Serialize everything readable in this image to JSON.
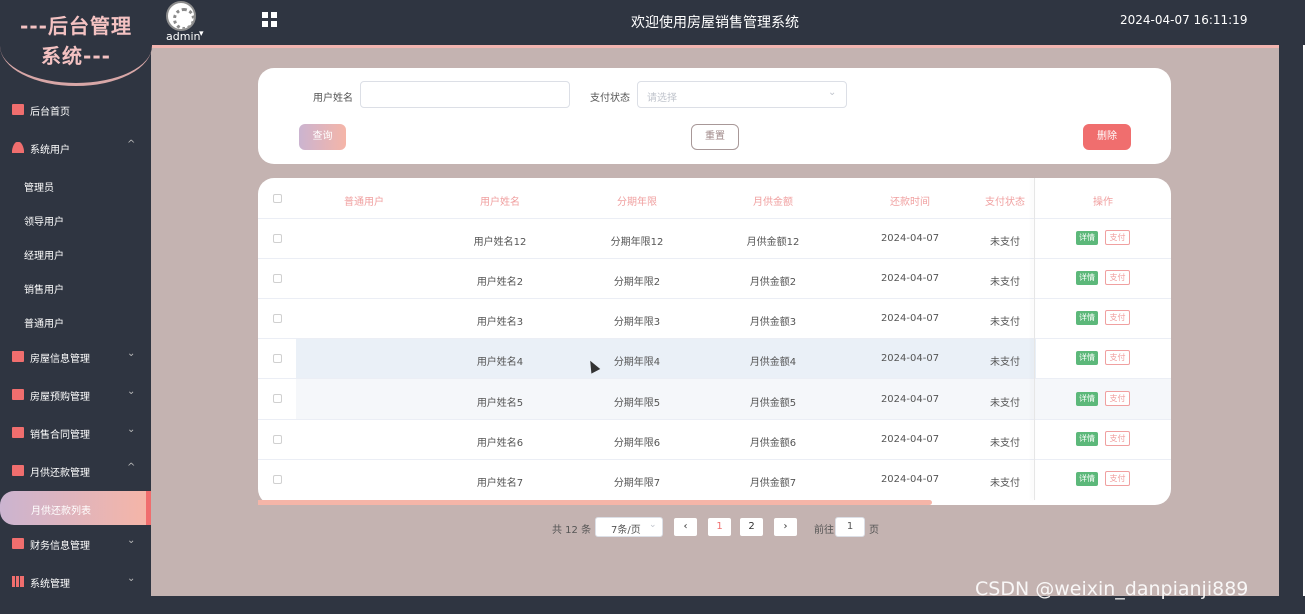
{
  "brand": {
    "line1": "---后台管理",
    "line2": "系统---"
  },
  "header": {
    "user": "admin",
    "title": "欢迎使用房屋销售管理系统",
    "datetime": "2024-04-07 16:11:19"
  },
  "sidebar": {
    "items": [
      {
        "label": "后台首页",
        "icon": "monitor-icon"
      },
      {
        "label": "系统用户",
        "icon": "user-icon",
        "expanded": true
      },
      {
        "label": "管理员"
      },
      {
        "label": "领导用户"
      },
      {
        "label": "经理用户"
      },
      {
        "label": "销售用户"
      },
      {
        "label": "普通用户"
      },
      {
        "label": "房屋信息管理",
        "icon": "chart-icon"
      },
      {
        "label": "房屋预购管理",
        "icon": "chart-icon"
      },
      {
        "label": "销售合同管理",
        "icon": "chart-icon"
      },
      {
        "label": "月供还款管理",
        "icon": "chart-icon",
        "expanded": true
      },
      {
        "label": "月供还款列表",
        "active": true
      },
      {
        "label": "财务信息管理",
        "icon": "chart-icon"
      },
      {
        "label": "系统管理",
        "icon": "bar-chart-icon"
      }
    ]
  },
  "search": {
    "username_label": "用户姓名",
    "username_value": "",
    "status_label": "支付状态",
    "status_placeholder": "请选择",
    "query_label": "查询",
    "reset_label": "重置",
    "delete_label": "删除"
  },
  "table": {
    "headers": [
      "普通用户",
      "用户姓名",
      "分期年限",
      "月供金额",
      "还款时间",
      "支付状态",
      "操作"
    ],
    "rows": [
      {
        "user": "",
        "name": "用户姓名12",
        "years": "分期年限12",
        "amount": "月供金额12",
        "date": "2024-04-07",
        "status": "未支付"
      },
      {
        "user": "",
        "name": "用户姓名2",
        "years": "分期年限2",
        "amount": "月供金额2",
        "date": "2024-04-07",
        "status": "未支付"
      },
      {
        "user": "",
        "name": "用户姓名3",
        "years": "分期年限3",
        "amount": "月供金额3",
        "date": "2024-04-07",
        "status": "未支付"
      },
      {
        "user": "",
        "name": "用户姓名4",
        "years": "分期年限4",
        "amount": "月供金额4",
        "date": "2024-04-07",
        "status": "未支付"
      },
      {
        "user": "",
        "name": "用户姓名5",
        "years": "分期年限5",
        "amount": "月供金额5",
        "date": "2024-04-07",
        "status": "未支付"
      },
      {
        "user": "",
        "name": "用户姓名6",
        "years": "分期年限6",
        "amount": "月供金额6",
        "date": "2024-04-07",
        "status": "未支付"
      },
      {
        "user": "",
        "name": "用户姓名7",
        "years": "分期年限7",
        "amount": "月供金额7",
        "date": "2024-04-07",
        "status": "未支付"
      }
    ],
    "detail_label": "详情",
    "pay_label": "支付"
  },
  "pagination": {
    "total": "共 12 条",
    "page_size": "7条/页",
    "pages": [
      "1",
      "2"
    ],
    "current": "1",
    "goto_label": "前往",
    "goto_value": "1",
    "page_suffix": "页",
    "prev": "‹",
    "next": "›"
  },
  "watermark": "CSDN @weixin_danpianji889",
  "colors": {
    "accent": "#f06e6e",
    "sidebar": "#2f3541",
    "content_bg": "#c4b3b1",
    "detail_tag": "#5cb87a"
  }
}
